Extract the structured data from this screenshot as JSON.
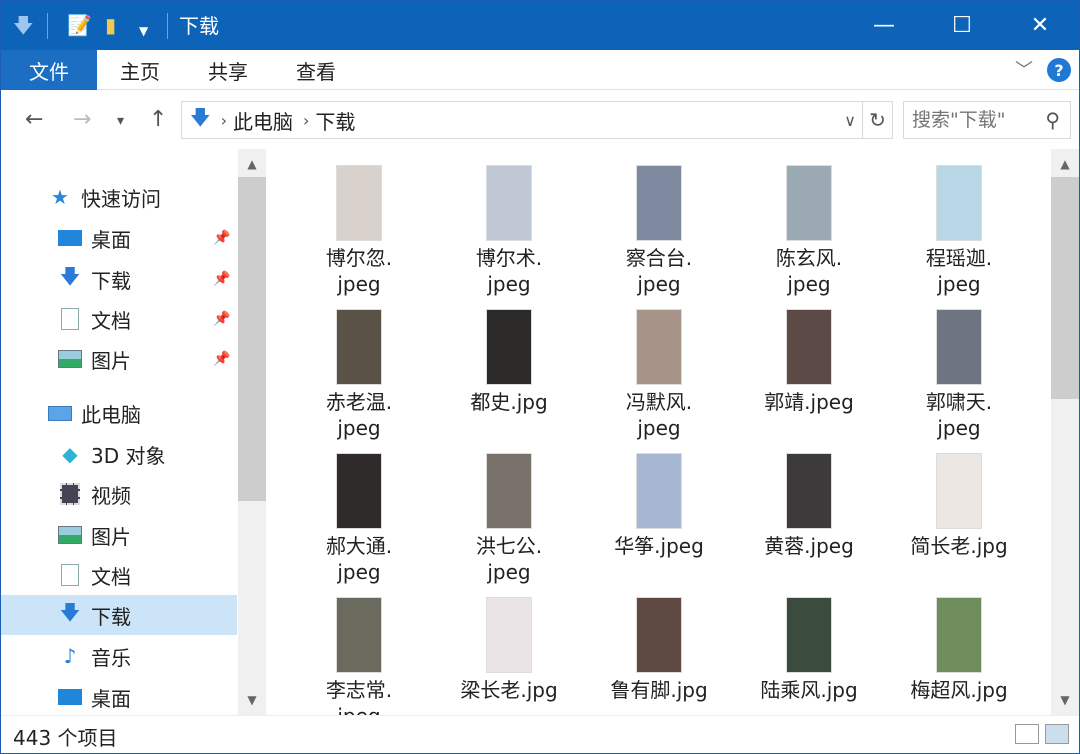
{
  "titlebar": {
    "title": "下载",
    "quick_access": [
      "down-arrow-icon",
      "properties-icon",
      "new-folder-icon",
      "chevron-down-icon"
    ]
  },
  "ribbon": {
    "tabs": [
      "文件",
      "主页",
      "共享",
      "查看"
    ]
  },
  "address": {
    "crumbs": [
      "此电脑",
      "下载"
    ]
  },
  "search": {
    "placeholder": "搜索\"下载\""
  },
  "sidebar": {
    "items": [
      {
        "label": "快速访问",
        "icon": "star-icon"
      },
      {
        "label": "桌面",
        "icon": "desktop-icon",
        "pinned": true
      },
      {
        "label": "下载",
        "icon": "download-icon",
        "pinned": true
      },
      {
        "label": "文档",
        "icon": "document-icon",
        "pinned": true
      },
      {
        "label": "图片",
        "icon": "pictures-icon",
        "pinned": true
      },
      {
        "label": "此电脑",
        "icon": "computer-icon"
      },
      {
        "label": "3D 对象",
        "icon": "cube-icon"
      },
      {
        "label": "视频",
        "icon": "video-icon"
      },
      {
        "label": "图片",
        "icon": "pictures-icon"
      },
      {
        "label": "文档",
        "icon": "document-icon"
      },
      {
        "label": "下载",
        "icon": "download-icon",
        "selected": true
      },
      {
        "label": "音乐",
        "icon": "music-icon"
      },
      {
        "label": "桌面",
        "icon": "desktop-icon"
      }
    ]
  },
  "files": [
    {
      "name": "博尔忽.\njpeg",
      "color": "#d9d2cc"
    },
    {
      "name": "博尔术.\njpeg",
      "color": "#bfc8d4"
    },
    {
      "name": "察合台.\njpeg",
      "color": "#7d8aa0"
    },
    {
      "name": "陈玄风.\njpeg",
      "color": "#9aa9b2"
    },
    {
      "name": "程瑶迦.\njpeg",
      "color": "#b8d6e6"
    },
    {
      "name": "赤老温.\njpeg",
      "color": "#5a5147"
    },
    {
      "name": "都史.jpg",
      "color": "#2c2a29"
    },
    {
      "name": "冯默风.\njpeg",
      "color": "#a69488"
    },
    {
      "name": "郭靖.jpeg",
      "color": "#5b4a45"
    },
    {
      "name": "郭啸天.\njpeg",
      "color": "#6f7580"
    },
    {
      "name": "郝大通.\njpeg",
      "color": "#2f2b2a"
    },
    {
      "name": "洪七公.\njpeg",
      "color": "#78726b"
    },
    {
      "name": "华筝.jpeg",
      "color": "#a7b7d1"
    },
    {
      "name": "黄蓉.jpeg",
      "color": "#3c3a3a"
    },
    {
      "name": "简长老.jpg",
      "color": "#ede7e4"
    },
    {
      "name": "李志常.\njpeg",
      "color": "#6a6a5e"
    },
    {
      "name": "梁长老.jpg",
      "color": "#ebe4e6"
    },
    {
      "name": "鲁有脚.jpg",
      "color": "#5e4a40"
    },
    {
      "name": "陆乘风.jpg",
      "color": "#3b4c3f"
    },
    {
      "name": "梅超风.jpg",
      "color": "#6f8c5c"
    }
  ],
  "status": {
    "count": "443 个项目"
  }
}
